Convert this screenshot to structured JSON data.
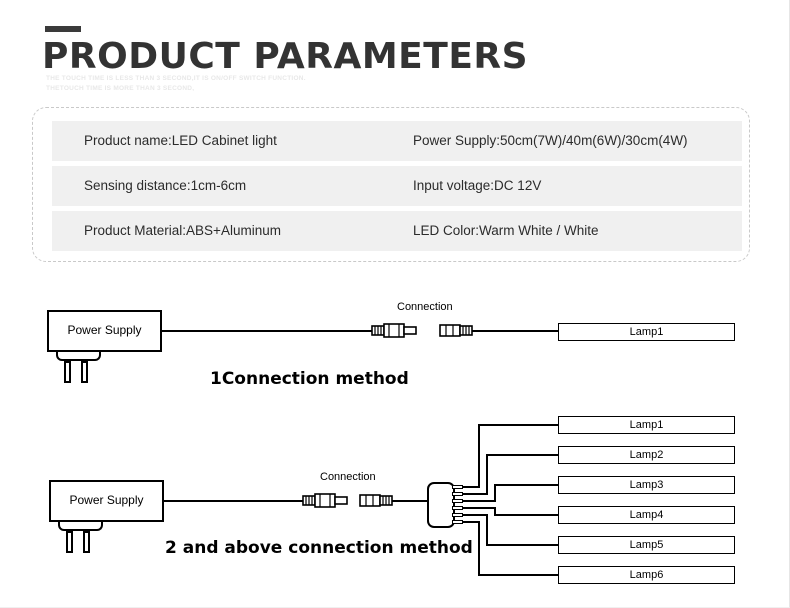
{
  "header": {
    "title": "PRODUCT PARAMETERS",
    "subtitle_line1": "THE TOUCH TIME IS LESS THAN 3 SECOND,IT IS ON/OFF SWITCH FUNCTION.",
    "subtitle_line2": "THETOUCH TIME IS MORE THAN 3 SECOND,",
    "accent_color": "#3a3a3a"
  },
  "spec_table": {
    "rows": [
      {
        "left": "Product name:LED Cabinet light",
        "right": "Power Supply:50cm(7W)/40m(6W)/30cm(4W)"
      },
      {
        "left": "Sensing distance:1cm-6cm",
        "right": "Input voltage:DC 12V"
      },
      {
        "left": "Product Material:ABS+Aluminum",
        "right": "LED Color:Warm White / White"
      }
    ],
    "row_bg": "#f0f0f0",
    "border_color": "#c9c9c9"
  },
  "diagram1": {
    "power_supply_label": "Power Supply",
    "connection_label": "Connection",
    "method_label": "1Connection method",
    "lamps": [
      "Lamp1"
    ]
  },
  "diagram2": {
    "power_supply_label": "Power Supply",
    "connection_label": "Connection",
    "method_label": "2 and above connection method",
    "lamps": [
      "Lamp1",
      "Lamp2",
      "Lamp3",
      "Lamp4",
      "Lamp5",
      "Lamp6"
    ]
  }
}
